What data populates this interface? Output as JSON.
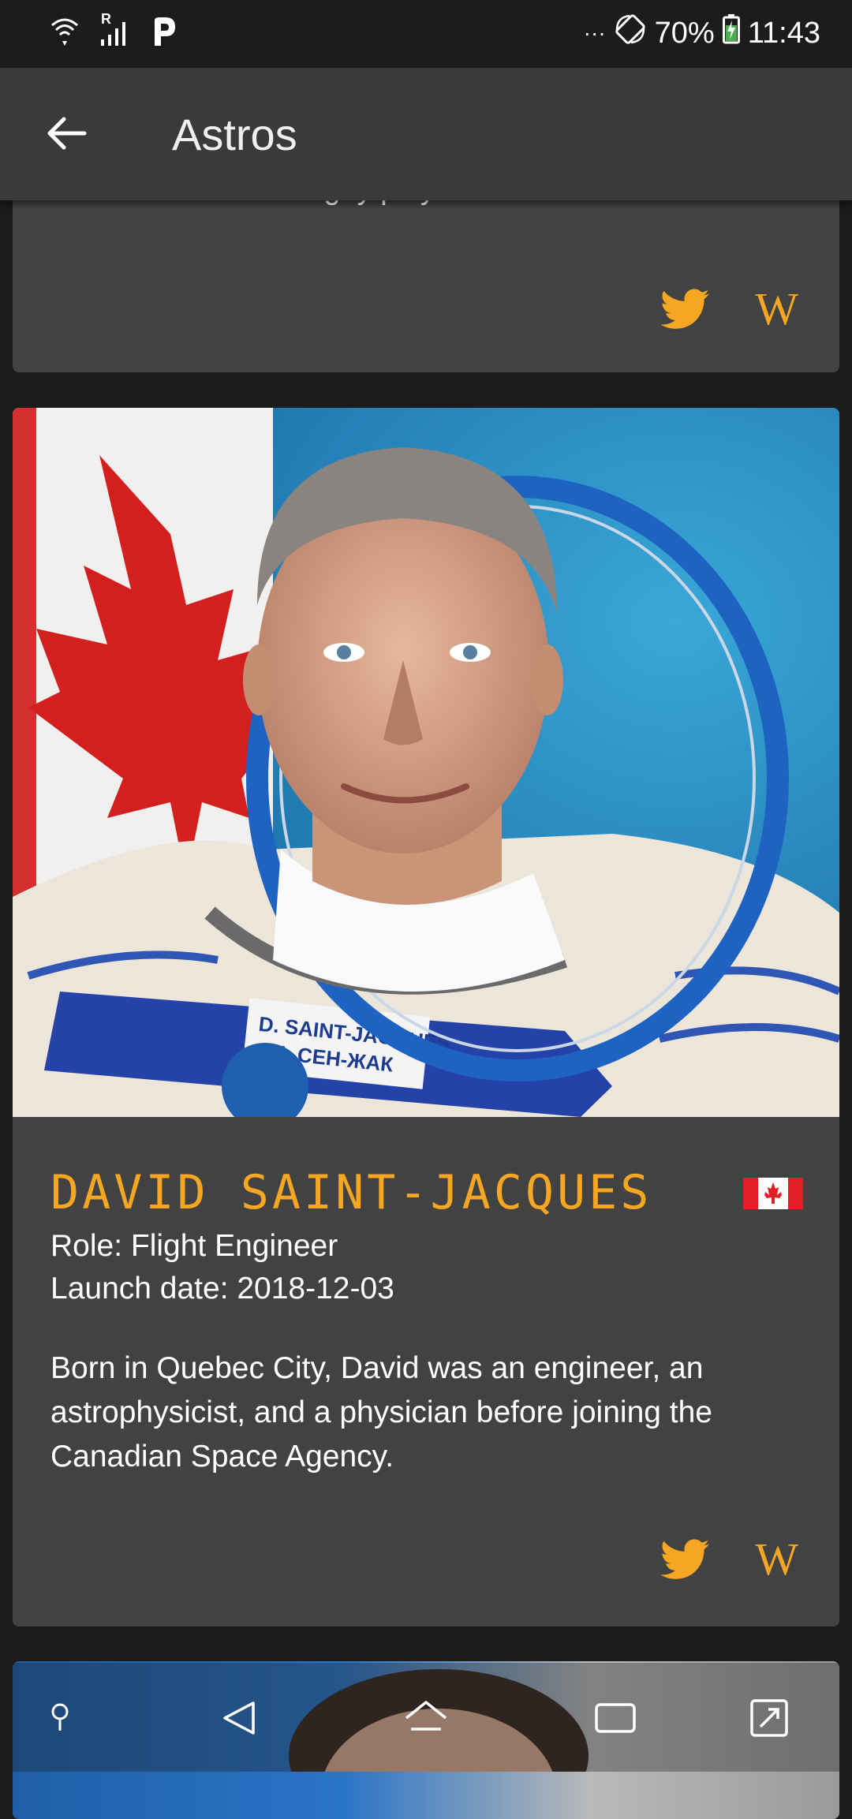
{
  "status_bar": {
    "battery": "70%",
    "time": "11:43",
    "signal_label": "R",
    "dots": "···"
  },
  "app_bar": {
    "title": "Astros"
  },
  "cards": [
    {
      "bio_partial": "a world-renowned rugby player.",
      "links": {
        "twitter": "twitter-icon",
        "wikipedia": "W"
      }
    },
    {
      "name": "DAVID SAINT-JACQUES",
      "country_flag": "canada-flag-icon",
      "role": "Role: Flight Engineer",
      "launch_date": "Launch date: 2018-12-03",
      "bio": "Born in Quebec City, David was an engineer, an astrophysicist, and a physician before joining the Canadian Space Agency.",
      "suit_patch_line1": "D. SAINT-JACQUES",
      "suit_patch_line2": "Д. СЕН-ЖАК",
      "links": {
        "twitter": "twitter-icon",
        "wikipedia": "W"
      }
    }
  ],
  "nav_bar": {
    "items": [
      "pin-icon",
      "back-triangle-icon",
      "home-icon",
      "recents-icon",
      "expand-icon"
    ]
  },
  "colors": {
    "accent": "#f5a623",
    "card": "#424242",
    "appbar": "#3a3a3a",
    "background": "#1b1b1b"
  }
}
